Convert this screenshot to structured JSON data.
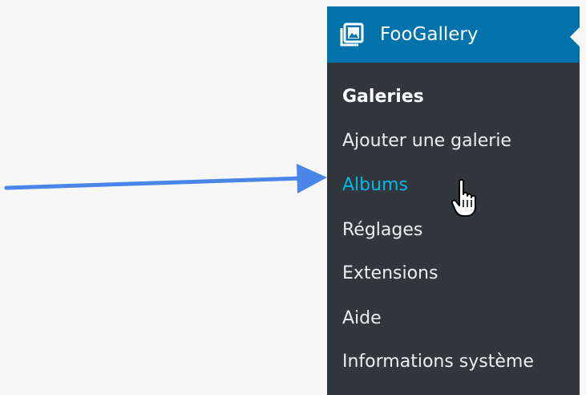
{
  "menu": {
    "title": "FooGallery",
    "icon": "gallery-icon",
    "accent_color": "#0073aa",
    "background_color": "#32373c",
    "hover_color": "#00b9eb",
    "items": [
      {
        "label": "Galeries",
        "state": "current"
      },
      {
        "label": "Ajouter une galerie",
        "state": "normal"
      },
      {
        "label": "Albums",
        "state": "hover"
      },
      {
        "label": "Réglages",
        "state": "normal"
      },
      {
        "label": "Extensions",
        "state": "normal"
      },
      {
        "label": "Aide",
        "state": "normal"
      },
      {
        "label": "Informations système",
        "state": "normal"
      }
    ]
  },
  "annotation": {
    "arrow_color": "#4a86e8",
    "arrow_icon": "arrow-right-icon",
    "cursor_icon": "hand-pointer-icon"
  }
}
